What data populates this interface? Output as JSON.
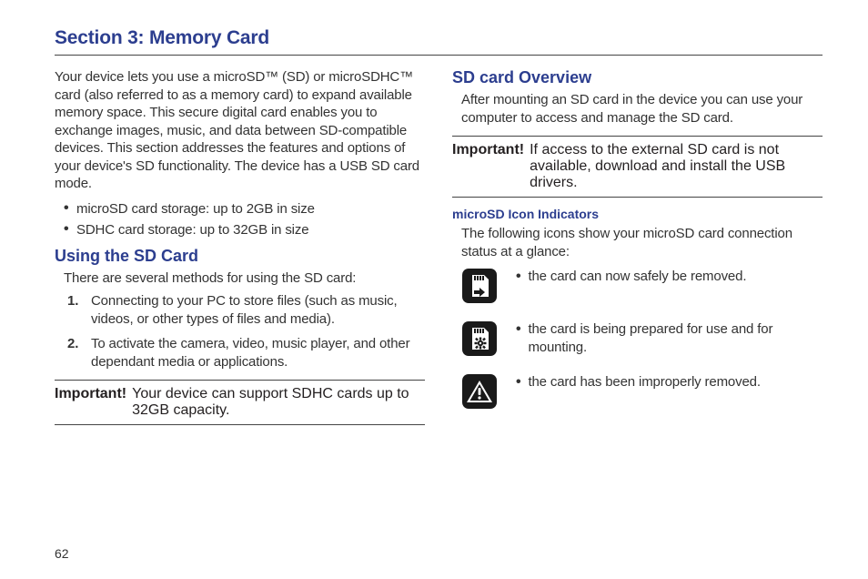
{
  "section_title": "Section 3: Memory Card",
  "page_number": "62",
  "left": {
    "intro": "Your device lets you use a microSD™ (SD) or microSDHC™ card (also referred to as a memory card) to expand available memory space. This secure digital card enables you to exchange images, music, and data between SD-compatible devices. This section addresses the features and options of your device's SD functionality. The device has a USB SD card mode.",
    "bullets": [
      "microSD card storage: up to 2GB in size",
      "SDHC card storage: up to 32GB in size"
    ],
    "using_heading": "Using the SD Card",
    "using_intro": "There are several methods for using the SD card:",
    "steps": [
      "Connecting to your PC to store files (such as music, videos, or other types of files and media).",
      "To activate the camera, video, music player, and other dependant media or applications."
    ],
    "important_label": "Important!",
    "important_text": "Your device can support SDHC cards up to 32GB capacity."
  },
  "right": {
    "overview_heading": "SD card Overview",
    "overview_text": "After mounting an SD card in the device you can use your computer to access and manage the SD card.",
    "important_label": "Important!",
    "important_text": "If access to the external SD card is not available, download and install the USB drivers.",
    "indicators_heading": "microSD Icon Indicators",
    "indicators_intro": "The following icons show your microSD card connection status at a glance:",
    "indicators": [
      "the card can now safely be removed.",
      "the card is being prepared for use and for mounting.",
      "the card has been improperly removed."
    ]
  }
}
